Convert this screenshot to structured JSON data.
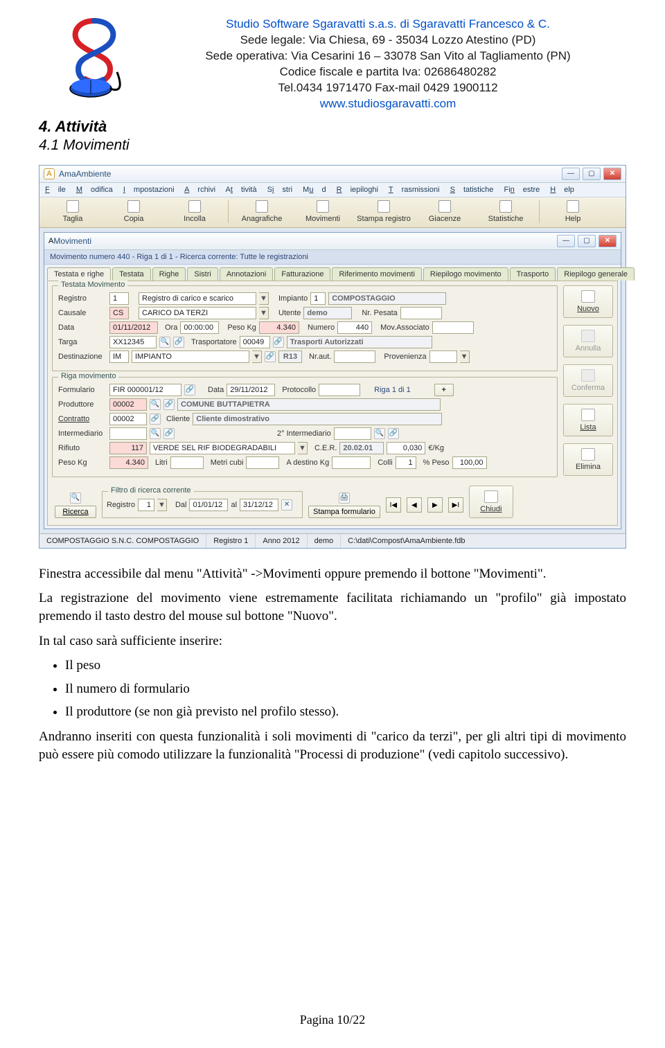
{
  "header": {
    "company": "Studio Software Sgaravatti s.a.s. di Sgaravatti Francesco & C.",
    "line2": "Sede legale: Via Chiesa, 69 - 35034 Lozzo Atestino (PD)",
    "line3": "Sede operativa: Via Cesarini 16 – 33078 San Vito al Tagliamento (PN)",
    "line4": "Codice fiscale e partita Iva: 02686480282",
    "line5": "Tel.0434 1971470 Fax-mail 0429 1900112",
    "web": "www.studiosgaravatti.com"
  },
  "section": {
    "number": "4. Attività",
    "sub": "4.1 Movimenti"
  },
  "app": {
    "title": "AmaAmbiente",
    "menu": [
      "File",
      "Modifica",
      "Impostazioni",
      "Archivi",
      "Attività",
      "Sistri",
      "Mud",
      "Riepiloghi",
      "Trasmissioni",
      "Statistiche",
      "Finestre",
      "Help"
    ],
    "toolbar": [
      {
        "label": "Taglia"
      },
      {
        "label": "Copia"
      },
      {
        "label": "Incolla"
      },
      {
        "label": "Anagrafiche"
      },
      {
        "label": "Movimenti"
      },
      {
        "label": "Stampa registro"
      },
      {
        "label": "Giacenze"
      },
      {
        "label": "Statistiche"
      },
      {
        "label": "Help"
      }
    ],
    "inner_title": "Movimenti",
    "subtitle": "Movimento numero 440 - Riga 1 di 1 - Ricerca corrente: Tutte le registrazioni",
    "tabs": [
      "Testata e righe",
      "Testata",
      "Righe",
      "Sistri",
      "Annotazioni",
      "Fatturazione",
      "Riferimento movimenti",
      "Riepilogo movimento",
      "Trasporto",
      "Riepilogo generale"
    ],
    "side_buttons": {
      "nuovo": "Nuovo",
      "annulla": "Annulla",
      "conferma": "Conferma",
      "lista": "Lista",
      "elimina": "Elimina"
    },
    "testata_legend": "Testata Movimento",
    "testata": {
      "registro_lbl": "Registro",
      "registro": "1",
      "registro_desc": "Registro di carico e scarico",
      "impianto_lbl": "Impianto",
      "impianto": "1",
      "impianto_desc": "COMPOSTAGGIO",
      "causale_lbl": "Causale",
      "causale": "CS",
      "causale_desc": "CARICO DA TERZI",
      "utente_lbl": "Utente",
      "utente": "demo",
      "nrpesata_lbl": "Nr. Pesata",
      "nrpesata": "",
      "data_lbl": "Data",
      "data": "01/11/2012",
      "ora_lbl": "Ora",
      "ora": "00:00:00",
      "peso_lbl": "Peso Kg",
      "peso": "4.340",
      "numero_lbl": "Numero",
      "numero": "440",
      "movass_lbl": "Mov.Associato",
      "movass": "",
      "targa_lbl": "Targa",
      "targa": "XX12345",
      "trasp_lbl": "Trasportatore",
      "trasp": "00049",
      "trasp_desc": "Trasporti Autorizzati",
      "dest_lbl": "Destinazione",
      "dest": "IM",
      "dest_desc": "IMPIANTO",
      "r13": "R13",
      "nraut_lbl": "Nr.aut.",
      "nraut": "",
      "prov_lbl": "Provenienza",
      "prov": ""
    },
    "riga_legend": "Riga movimento",
    "riga": {
      "formulario_lbl": "Formulario",
      "formulario": "FIR 000001/12",
      "datar_lbl": "Data",
      "datar": "29/11/2012",
      "protocollo_lbl": "Protocollo",
      "protocollo": "",
      "rigapos": "Riga 1 di 1",
      "plus": "+",
      "produttore_lbl": "Produttore",
      "produttore": "00002",
      "produttore_desc": "COMUNE BUTTAPIETRA",
      "contratto_lbl": "Contratto",
      "contratto": "00002",
      "cliente_lbl": "Cliente",
      "cliente_desc": "Cliente dimostrativo",
      "interm_lbl": "Intermediario",
      "interm": "",
      "interm2_lbl": "2° Intermediario",
      "interm2": "",
      "rifiuto_lbl": "Rifiuto",
      "rifiuto": "117",
      "rifiuto_desc": "VERDE SEL RIF BIODEGRADABILI",
      "cer_lbl": "C.E.R.",
      "cer": "20.02.01",
      "prezzo": "0,030",
      "prezzo_unit": "€/Kg",
      "pesokg_lbl": "Peso Kg",
      "pesokg": "4.340",
      "litri_lbl": "Litri",
      "litri": "",
      "mcubi_lbl": "Metri cubi",
      "mcubi": "",
      "adest_lbl": "A destino Kg",
      "adest": "",
      "colli_lbl": "Colli",
      "colli": "1",
      "pctpeso_lbl": "% Peso",
      "pctpeso": "100,00"
    },
    "footer": {
      "ricerca_btn": "Ricerca",
      "filtro_legend": "Filtro di ricerca corrente",
      "filtro_reg_lbl": "Registro",
      "filtro_reg": "1",
      "dal_lbl": "Dal",
      "dal": "01/01/12",
      "al_lbl": "al",
      "al": "31/12/12",
      "stampa_form": "Stampa formulario",
      "chiudi": "Chiudi"
    },
    "status": {
      "c1": "COMPOSTAGGIO S.N.C. COMPOSTAGGIO",
      "c2": "Registro 1",
      "c3": "Anno 2012",
      "c4": "demo",
      "c5": "C:\\dati\\Compost\\AmaAmbiente.fdb"
    }
  },
  "body": {
    "p1": "Finestra accessibile dal menu \"Attività\" ->Movimenti oppure premendo il bottone \"Movimenti\".",
    "p2": "La registrazione del movimento viene estremamente facilitata richiamando un \"profilo\" già impostato premendo il tasto destro del mouse sul bottone \"Nuovo\".",
    "p3": "In tal caso sarà sufficiente inserire:",
    "li1": "Il peso",
    "li2": "Il numero di formulario",
    "li3": "Il produttore (se non già previsto nel profilo stesso).",
    "p4": "Andranno inseriti con questa funzionalità i soli movimenti di \"carico da terzi\", per gli altri tipi di movimento può essere più comodo utilizzare la funzionalità \"Processi di produzione\" (vedi capitolo successivo)."
  },
  "page_footer": "Pagina 10/22"
}
